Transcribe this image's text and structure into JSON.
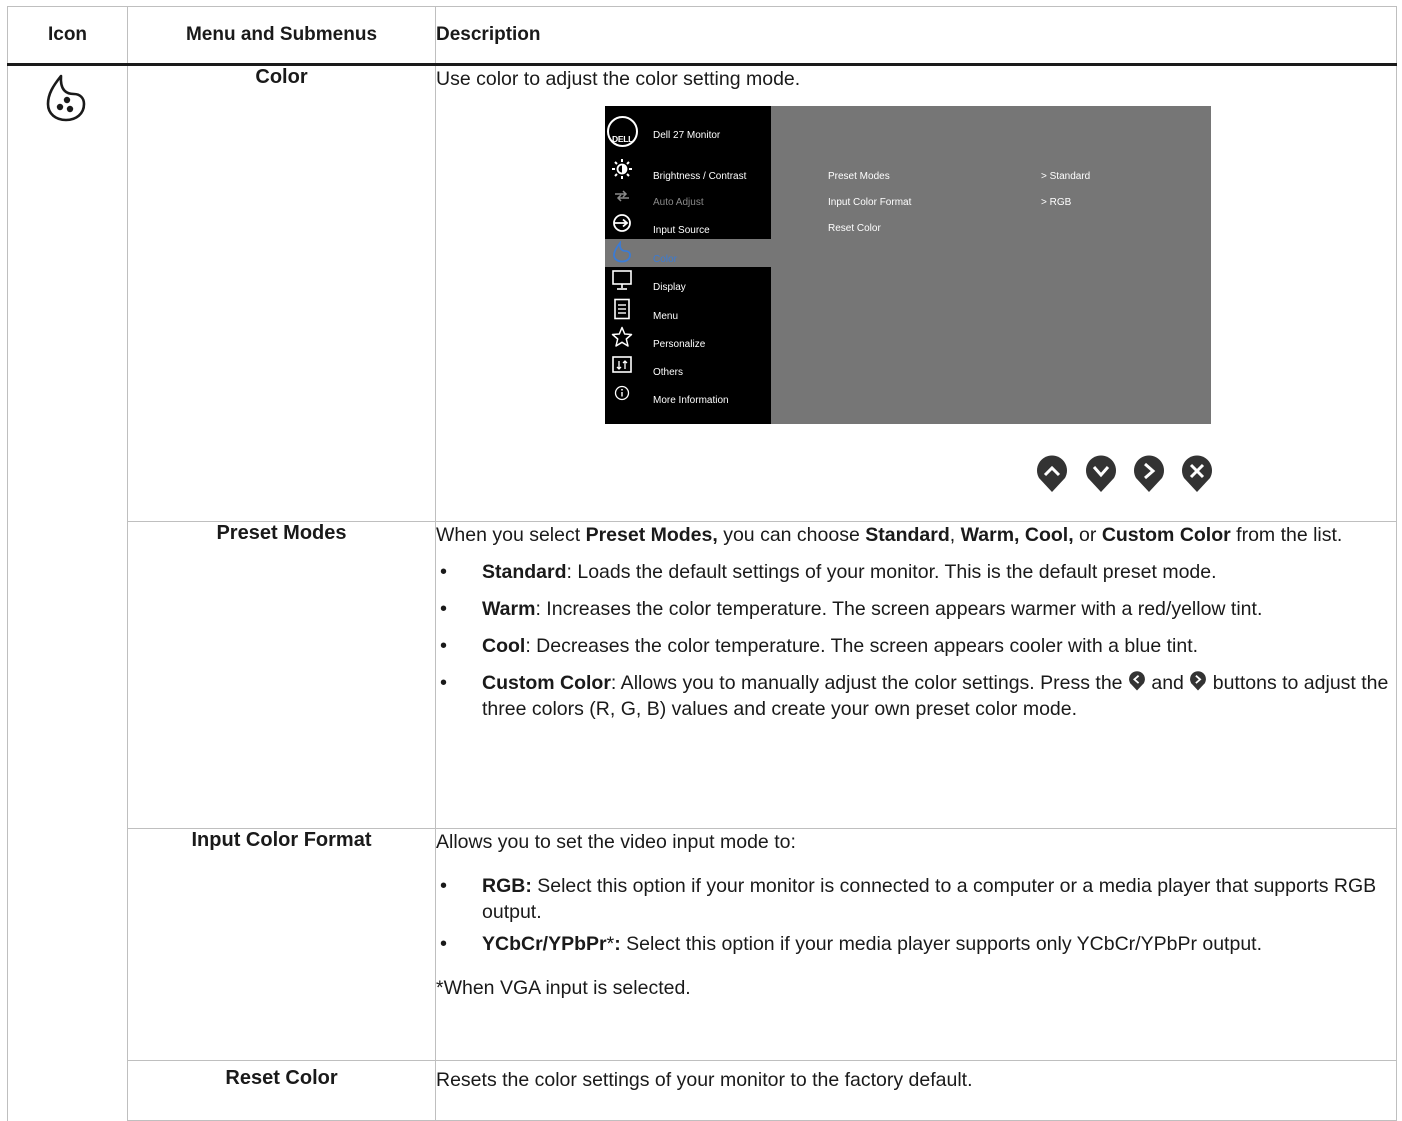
{
  "table": {
    "headers": {
      "icon": "Icon",
      "menu": "Menu and Submenus",
      "desc": "Description"
    }
  },
  "color": {
    "menu_label": "Color",
    "desc": "Use color to adjust the color setting mode."
  },
  "osd": {
    "logo": "DELL",
    "title": "Dell 27 Monitor",
    "items": [
      {
        "label": "Brightness / Contrast",
        "icon": "brightness-icon"
      },
      {
        "label": "Auto Adjust",
        "icon": "auto-adjust-icon"
      },
      {
        "label": "Input Source",
        "icon": "input-source-icon"
      },
      {
        "label": "Color",
        "icon": "color-icon"
      },
      {
        "label": "Display",
        "icon": "display-icon"
      },
      {
        "label": "Menu",
        "icon": "menu-icon"
      },
      {
        "label": "Personalize",
        "icon": "star-icon"
      },
      {
        "label": "Others",
        "icon": "others-icon"
      },
      {
        "label": "More Information",
        "icon": "info-icon"
      }
    ],
    "options": [
      {
        "label": "Preset Modes",
        "value": ">  Standard"
      },
      {
        "label": "Input Color Format",
        "value": ">  RGB"
      },
      {
        "label": "Reset Color",
        "value": ""
      }
    ],
    "buttons": [
      "up-button-icon",
      "down-button-icon",
      "right-button-icon",
      "exit-button-icon"
    ]
  },
  "preset": {
    "menu_label": "Preset Modes",
    "intro": {
      "t1": "When you select ",
      "b1": "Preset Modes,",
      "t2": " you can choose ",
      "b2": "Standard",
      "t3": ", ",
      "b3": "Warm, Cool,",
      "t4": " or ",
      "b4": "Custom Color",
      "t5": " from the list."
    },
    "bullets": {
      "standard_b": "Standard",
      "standard_t": ": Loads the default settings of your monitor. This is the default preset mode.",
      "warm_b": "Warm",
      "warm_t": ": Increases the color temperature. The screen appears warmer with a red/yellow tint.",
      "cool_b": "Cool",
      "cool_t": ": Decreases the color temperature. The screen appears cooler with a blue tint.",
      "custom_b": "Custom Color",
      "custom_t1": ": Allows you to manually adjust the color settings. Press the ",
      "custom_t2": " and ",
      "custom_t3": " buttons to adjust the three colors (R, G, B) values and create your own preset color mode."
    }
  },
  "input": {
    "menu_label": "Input Color Format",
    "intro": "Allows you to set the video input mode to:",
    "rgb_b": "RGB:",
    "rgb_t": " Select this option if your monitor is connected to a computer or a media player that supports RGB output.",
    "ycbcr_b": "YCbCr/YPbPr",
    "ycbcr_star": "*",
    "ycbcr_colon": ":",
    "ycbcr_t": " Select this option if your media player supports only YCbCr/YPbPr output.",
    "note": "*When VGA input is selected."
  },
  "reset": {
    "menu_label": "Reset Color",
    "desc": "Resets the color settings of your monitor to the factory default."
  },
  "colors": {
    "osd_panel": "#767676",
    "osd_menu": "#000000",
    "selected_label": "#3a7bd5",
    "button_fill": "#333333"
  }
}
